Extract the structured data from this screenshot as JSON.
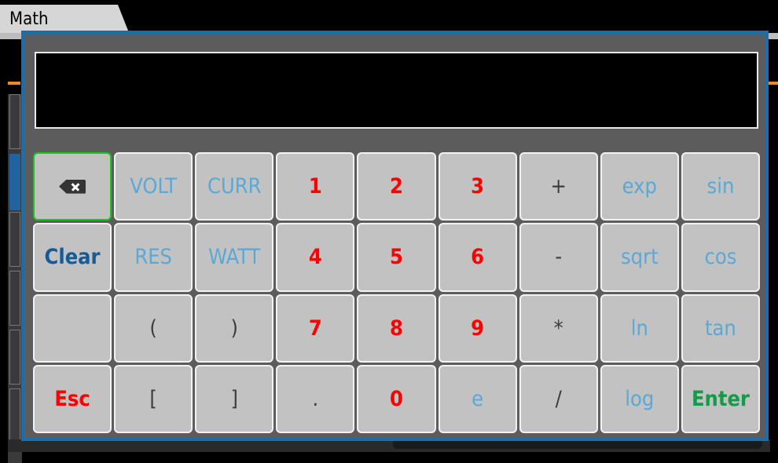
{
  "header": {
    "tab_title": "Math"
  },
  "display": {
    "value": ""
  },
  "keypad": {
    "backspace": "backspace-icon",
    "volt": "VOLT",
    "curr": "CURR",
    "k1": "1",
    "k2": "2",
    "k3": "3",
    "plus": "+",
    "exp": "exp",
    "sin": "sin",
    "clear": "Clear",
    "res": "RES",
    "watt": "WATT",
    "k4": "4",
    "k5": "5",
    "k6": "6",
    "minus": "-",
    "sqrt": "sqrt",
    "cos": "cos",
    "blank": "",
    "lparen": "(",
    "rparen": ")",
    "k7": "7",
    "k8": "8",
    "k9": "9",
    "multiply": "*",
    "ln": "ln",
    "tan": "tan",
    "esc": "Esc",
    "lbracket": "[",
    "rbracket": "]",
    "dot": ".",
    "k0": "0",
    "e": "e",
    "divide": "/",
    "log": "log",
    "enter": "Enter"
  },
  "colors": {
    "dialog_border": "#1b6fa8",
    "key_bg": "#c2c2c2",
    "function_text": "#5aa8d6",
    "digit_text": "#ff0000",
    "clear_text": "#175a96",
    "enter_text": "#149a49",
    "esc_text": "#ff0000",
    "active_border": "#1ec41e"
  }
}
